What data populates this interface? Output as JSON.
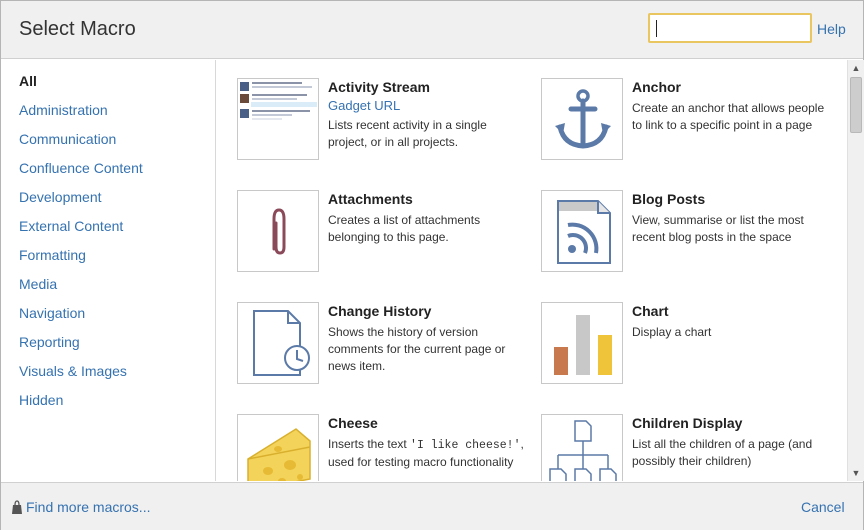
{
  "dialog": {
    "title": "Select Macro",
    "search": {
      "value": "",
      "placeholder": ""
    },
    "help_label": "Help"
  },
  "sidebar": {
    "items": [
      {
        "label": "All",
        "active": true
      },
      {
        "label": "Administration"
      },
      {
        "label": "Communication"
      },
      {
        "label": "Confluence Content"
      },
      {
        "label": "Development"
      },
      {
        "label": "External Content"
      },
      {
        "label": "Formatting"
      },
      {
        "label": "Media"
      },
      {
        "label": "Navigation"
      },
      {
        "label": "Reporting"
      },
      {
        "label": "Visuals & Images"
      },
      {
        "label": "Hidden"
      }
    ]
  },
  "macros": [
    {
      "name": "Activity Stream",
      "link": "Gadget URL",
      "description": "Lists recent activity in a single project, or in all projects.",
      "icon": "activity-stream-thumbnail"
    },
    {
      "name": "Anchor",
      "description": "Create an anchor that allows people to link to a specific point in a page",
      "icon": "anchor-icon"
    },
    {
      "name": "Attachments",
      "description": "Creates a list of attachments belonging to this page.",
      "icon": "paperclip-icon"
    },
    {
      "name": "Blog Posts",
      "description": "View, summarise or list the most recent blog posts in the space",
      "icon": "rss-document-icon"
    },
    {
      "name": "Change History",
      "description": "Shows the history of version comments for the current page or news item.",
      "icon": "document-clock-icon"
    },
    {
      "name": "Chart",
      "description": "Display a chart",
      "icon": "bar-chart-icon"
    },
    {
      "name": "Cheese",
      "description_pre": "Inserts the text ",
      "description_code": "'I like cheese!'",
      "description_post": ", used for testing macro functionality",
      "icon": "cheese-icon"
    },
    {
      "name": "Children Display",
      "description": "List all the children of a page (and possibly their children)",
      "icon": "page-tree-icon"
    }
  ],
  "footer": {
    "find_more_label": "Find more macros...",
    "cancel_label": "Cancel"
  },
  "colors": {
    "link": "#3572b0",
    "search_border": "#e9c65f",
    "icon_blue": "#5b7aa8",
    "icon_maroon": "#8b4a5a"
  }
}
